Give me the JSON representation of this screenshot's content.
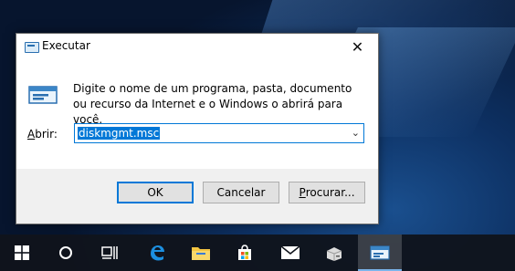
{
  "dialog": {
    "title": "Executar",
    "close_glyph": "✕",
    "description": "Digite o nome de um programa, pasta, documento ou recurso da Internet e o Windows o abrirá para você.",
    "open_label_first": "A",
    "open_label_rest": "brir:",
    "input_value": "diskmgmt.msc",
    "dropdown_glyph": "⌄",
    "buttons": {
      "ok": "OK",
      "cancel": "Cancelar",
      "browse_first": "P",
      "browse_rest": "rocurar..."
    }
  },
  "taskbar": {
    "items": [
      {
        "icon": "windows-start-icon"
      },
      {
        "icon": "search-circle-icon"
      },
      {
        "icon": "task-view-icon"
      },
      {
        "icon": "edge-browser-icon"
      },
      {
        "icon": "file-explorer-icon"
      },
      {
        "icon": "store-icon"
      },
      {
        "icon": "mail-icon"
      },
      {
        "icon": "network-storage-icon"
      },
      {
        "icon": "run-app-icon"
      }
    ]
  },
  "colors": {
    "accent": "#0078d7",
    "dialog_bg": "#f0f0f0",
    "taskbar_bg": "#10141c"
  }
}
